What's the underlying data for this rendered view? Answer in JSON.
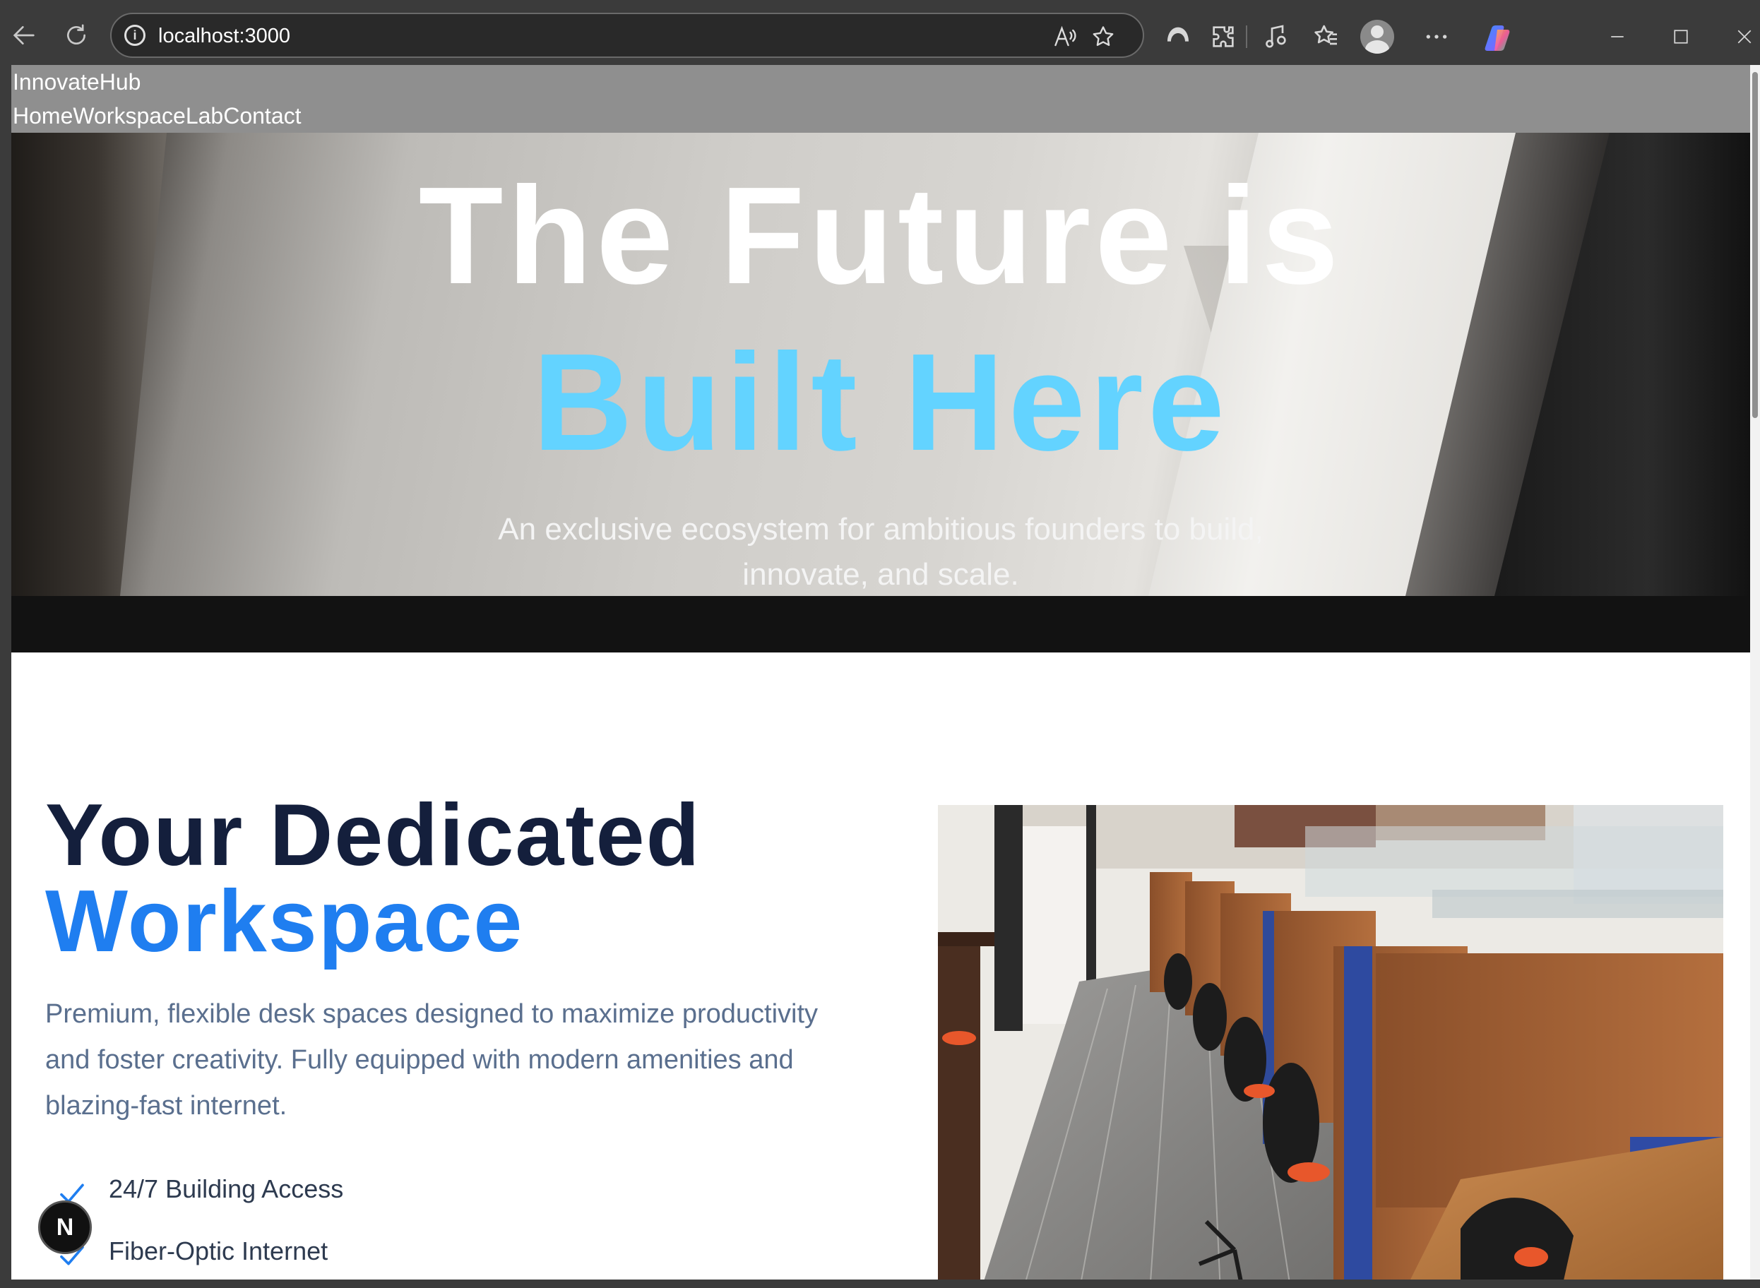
{
  "browser": {
    "url": "localhost:3000"
  },
  "site": {
    "brand": "InnovateHub",
    "nav": [
      "Home",
      "Workspace",
      "Lab",
      "Contact"
    ]
  },
  "hero": {
    "title_line1": "The Future is",
    "title_line2": "Built Here",
    "subtitle": "An exclusive ecosystem for ambitious founders to build, innovate, and scale.",
    "accent_color": "#63d3ff"
  },
  "workspace": {
    "title_line1": "Your Dedicated",
    "title_line2": "Workspace",
    "description": "Premium, flexible desk spaces designed to maximize productivity and foster creativity. Fully equipped with modern amenities and blazing-fast internet.",
    "features": [
      "24/7 Building Access",
      "Fiber-Optic Internet"
    ],
    "accent_color": "#1f7ef0",
    "title_color": "#141f3c"
  },
  "dev_badge": {
    "label": "N"
  }
}
